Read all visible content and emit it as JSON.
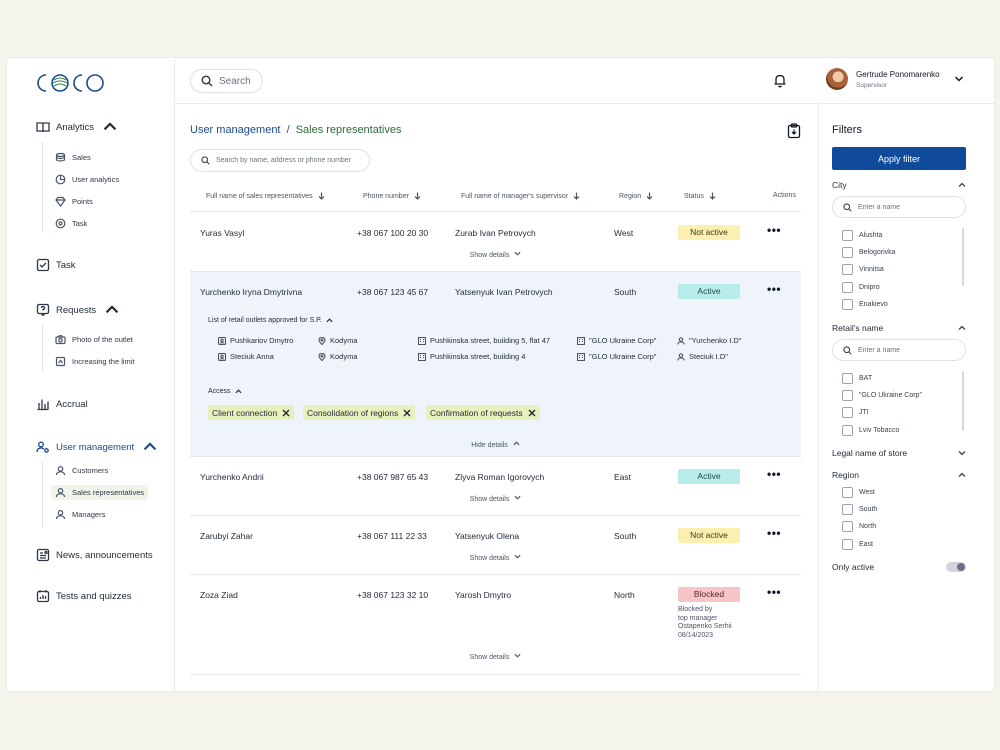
{
  "brand": {
    "logo_text": "COCO",
    "accent": "#1b4a8f",
    "logo_green": "#3a8a4c"
  },
  "nav": {
    "analytics": {
      "label": "Analytics",
      "children": [
        "Sales",
        "User analytics",
        "Points",
        "Task"
      ]
    },
    "task": "Task",
    "requests": {
      "label": "Requests",
      "children": [
        "Photo of the outlet",
        "Increasing the limit"
      ]
    },
    "accrual": "Accrual",
    "user_management": {
      "label": "User management",
      "children": [
        "Customers",
        "Sales representatives",
        "Managers"
      ]
    },
    "news": "News, announcements",
    "tests": "Tests and quizzes"
  },
  "topbar": {
    "search_label": "Search",
    "user_name": "Gertrude Ponomarenko",
    "user_role": "Supervisor"
  },
  "breadcrumb": {
    "parent": "User management",
    "separator": "/",
    "current": "Sales representatives"
  },
  "table": {
    "search_placeholder": "Search by name, address or phone number",
    "columns": [
      "Full name of sales representatives",
      "Phone number",
      "Full name of manager's supervisor",
      "Region",
      "Status",
      "Actions"
    ],
    "show_details": "Show details",
    "hide_details": "Hide details",
    "rows": [
      {
        "name": "Yuras Vasyl",
        "phone": "+38 067 100 20 30",
        "supervisor": "Zurab Ivan Petrovych",
        "region": "West",
        "status": "Not active"
      },
      {
        "name": "Yurchenko Iryna Dmytrivna",
        "phone": "+38 067 123 45 67",
        "supervisor": "Yatsenyuk Ivan Petrovych",
        "region": "South",
        "status": "Active"
      },
      {
        "name": "Yurchenko Andrii",
        "phone": "+38 067 987 65 43",
        "supervisor": "Zlyva Roman Igorovych",
        "region": "East",
        "status": "Active"
      },
      {
        "name": "Zarubyi Zahar",
        "phone": "+38 067 111 22 33",
        "supervisor": "Yatsenyuk Olena",
        "region": "South",
        "status": "Not active"
      },
      {
        "name": "Zoza Ziad",
        "phone": "+38 067 123 32 10",
        "supervisor": "Yarosh Dmytro",
        "region": "North",
        "status": "Blocked"
      }
    ],
    "blocked_note": [
      "Blocked by",
      "top manager",
      "Ostapenko Serhii",
      "08/14/2023"
    ],
    "expanded": {
      "outlets_title": "List of retail outlets approved for S.P.",
      "outlets": [
        {
          "owner": "Pushkariov Dmytro",
          "city": "Kodyma",
          "address": "Pushkinska street, building 5, flat 47",
          "company": "\"GLO Ukraine Corp\"",
          "rep": "\"Yurchenko I.D\""
        },
        {
          "owner": "Steciuk Anna",
          "city": "Kodyma",
          "address": "Pushkinska street, building 4",
          "company": "\"GLO Ukraine Corp\"",
          "rep": "Steciuk I.D\""
        }
      ],
      "access_title": "Access",
      "access": [
        "Client connection",
        "Consolidation of regions",
        "Confirmation of requests"
      ]
    }
  },
  "filters": {
    "title": "Filters",
    "apply": "Apply filter",
    "city": {
      "label": "City",
      "placeholder": "Enter a name",
      "options": [
        "Alushta",
        "Belogorivka",
        "Vinnitsa",
        "Dnipro",
        "Enakievo"
      ]
    },
    "retail": {
      "label": "Retail's name",
      "placeholder": "Enter a name",
      "options": [
        "BAT",
        "\"GLO Ukraine Corp\"",
        "JTI",
        "Lviv Tobacco"
      ]
    },
    "legal": {
      "label": "Legal name of store"
    },
    "region": {
      "label": "Region",
      "options": [
        "West",
        "South",
        "North",
        "East"
      ]
    },
    "only_active": {
      "label": "Only active",
      "value": false
    }
  }
}
